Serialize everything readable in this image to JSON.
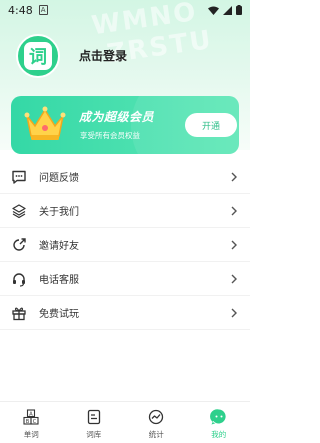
{
  "status_bar": {
    "time": "4:48",
    "notification": "A"
  },
  "profile": {
    "avatar_char": "词",
    "login_text": "点击登录"
  },
  "vip": {
    "title": "成为超级会员",
    "subtitle": "享受所有会员权益",
    "button": "开通"
  },
  "menu": [
    {
      "label": "问题反馈",
      "icon": "feedback-message-icon"
    },
    {
      "label": "关于我们",
      "icon": "layers-icon"
    },
    {
      "label": "邀请好友",
      "icon": "share-invite-icon"
    },
    {
      "label": "电话客服",
      "icon": "headset-icon"
    },
    {
      "label": "免费试玩",
      "icon": "gift-icon"
    }
  ],
  "tabs": [
    {
      "label": "单词",
      "icon": "abc-cards-icon"
    },
    {
      "label": "词库",
      "icon": "document-icon"
    },
    {
      "label": "统计",
      "icon": "chart-circle-icon"
    },
    {
      "label": "我的",
      "icon": "chat-bubble-icon",
      "active": true
    }
  ],
  "colors": {
    "accent": "#2ed08c",
    "card_start": "#34d8a6",
    "card_end": "#5fe7b7",
    "hero_bg": "#d3f6e4"
  }
}
